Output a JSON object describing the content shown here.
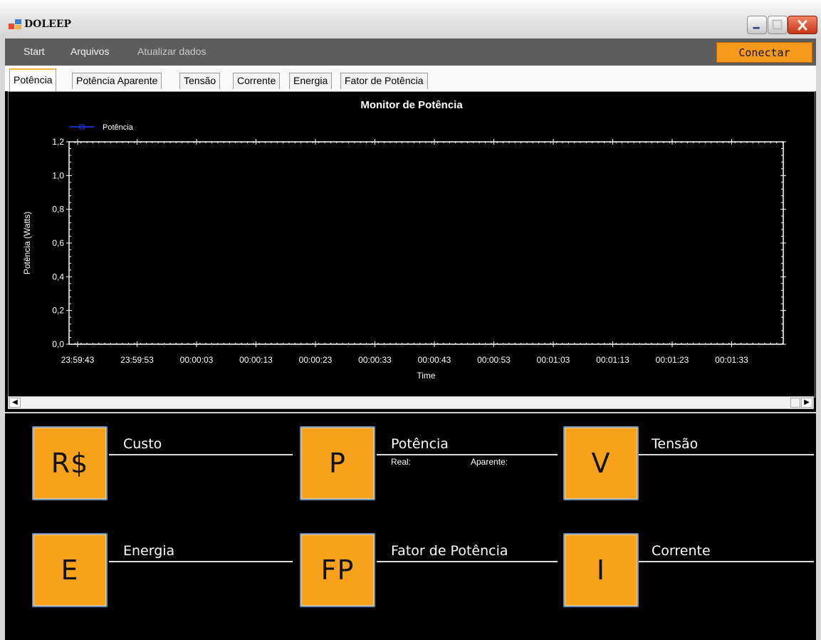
{
  "window": {
    "title": "DOLEEP"
  },
  "menu": {
    "items": [
      "Start",
      "Arquivos",
      "Atualizar dados"
    ],
    "connect_label": "Conectar"
  },
  "tabs": [
    "Potência",
    "Potência Aparente",
    "Tensão",
    "Corrente",
    "Energia",
    "Fator de Potência"
  ],
  "active_tab": "Potência",
  "chart_data": {
    "type": "line",
    "title": "Monitor de Potência",
    "xlabel": "Time",
    "ylabel": "Potência (Watts)",
    "legend": [
      "Potência"
    ],
    "legend_placement": "top-left",
    "series": [
      {
        "name": "Potência",
        "color": "#1f3bff",
        "values": []
      }
    ],
    "x_ticks": [
      "23:59:43",
      "23:59:53",
      "00:00:03",
      "00:00:13",
      "00:00:23",
      "00:00:33",
      "00:00:43",
      "00:00:53",
      "00:01:03",
      "00:01:13",
      "00:01:23",
      "00:01:33"
    ],
    "y_ticks": [
      "0,0",
      "0,2",
      "0,4",
      "0,6",
      "0,8",
      "1,0",
      "1,2"
    ],
    "ylim": [
      0,
      1.2
    ],
    "grid": false,
    "background": "#000000",
    "axis_color": "#ffffff"
  },
  "metrics": {
    "custo": {
      "icon": "R$",
      "label": "Custo",
      "value": ""
    },
    "potencia": {
      "icon": "P",
      "label": "Potência",
      "real_label": "Real:",
      "aparente_label": "Aparente:",
      "real_value": "",
      "aparente_value": ""
    },
    "tensao": {
      "icon": "V",
      "label": "Tensão",
      "value": ""
    },
    "energia": {
      "icon": "E",
      "label": "Energia",
      "value": ""
    },
    "fator": {
      "icon": "FP",
      "label": "Fator de Potência",
      "value": ""
    },
    "corrente": {
      "icon": "I",
      "label": "Corrente",
      "value": ""
    }
  },
  "colors": {
    "accent": "#f8a21b",
    "menubar": "#5d5d5d",
    "background": "#000000"
  }
}
